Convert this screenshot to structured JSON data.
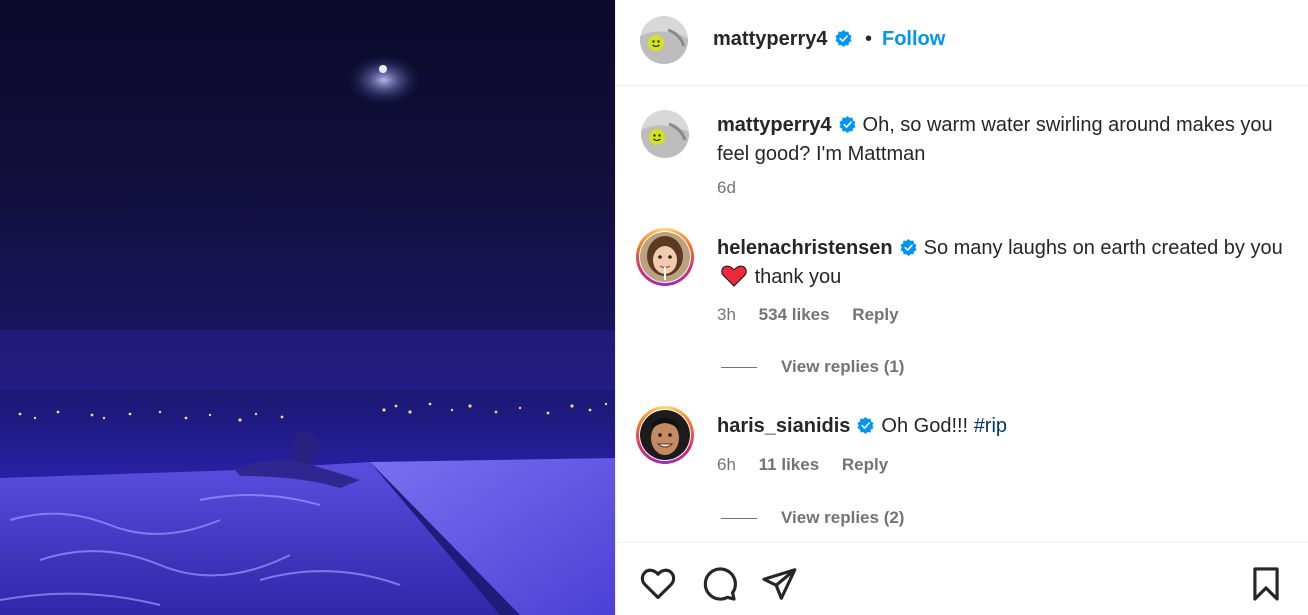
{
  "post": {
    "author": "mattyperry4",
    "follow_label": "Follow",
    "separator": "•",
    "caption": {
      "username": "mattyperry4",
      "text": "Oh, so warm water swirling around makes you feel good? I'm Mattman",
      "time": "6d"
    }
  },
  "comments": [
    {
      "username": "helenachristensen",
      "text_before": "So many laughs on earth created by you",
      "emoji": "heart",
      "text_after": "thank you",
      "time": "3h",
      "likes": "534 likes",
      "reply_label": "Reply",
      "view_replies": "View replies (1)"
    },
    {
      "username": "haris_sianidis",
      "text": "Oh God!!!",
      "hashtag": "#rip",
      "time": "6h",
      "likes": "11 likes",
      "reply_label": "Reply",
      "view_replies": "View replies (2)"
    }
  ],
  "actions": {
    "icons": [
      "heart-icon",
      "comment-icon",
      "share-icon",
      "bookmark-icon"
    ]
  },
  "colors": {
    "accent": "#0095f6",
    "verified": "#0095f6",
    "hashtag": "#00376b",
    "heart": "#ed2939"
  }
}
